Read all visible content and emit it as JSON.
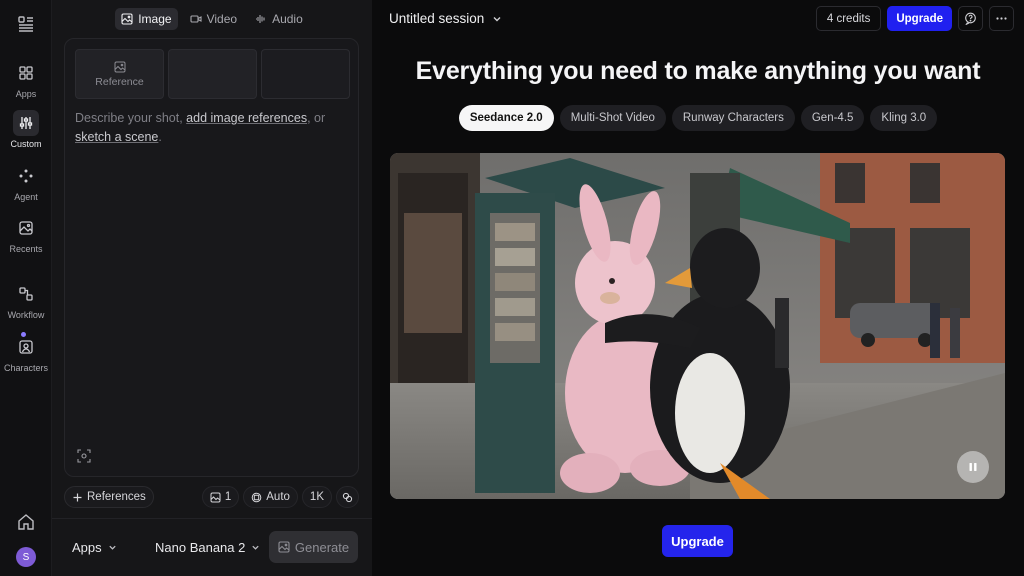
{
  "rail": {
    "items": [
      {
        "label": "Apps",
        "icon": "apps-grid-icon"
      },
      {
        "label": "Custom",
        "icon": "sliders-icon"
      },
      {
        "label": "Agent",
        "icon": "agent-nodes-icon"
      },
      {
        "label": "Recents",
        "icon": "recents-image-icon"
      },
      {
        "label": "Workflow",
        "icon": "workflow-icon"
      },
      {
        "label": "Characters",
        "icon": "character-icon"
      }
    ],
    "avatar_initial": "S",
    "active_item": "Custom"
  },
  "panel": {
    "modes": [
      {
        "label": "Image",
        "icon": "image-icon",
        "active": true
      },
      {
        "label": "Video",
        "icon": "video-icon",
        "active": false
      },
      {
        "label": "Audio",
        "icon": "audio-wave-icon",
        "active": false
      }
    ],
    "reference_slot_label": "Reference",
    "prompt": {
      "text_1": "Describe your shot, ",
      "link_1": "add image references",
      "text_2": ", or ",
      "link_2": "sketch a scene",
      "text_3": "."
    },
    "tools": {
      "references_label": "References",
      "count": "1",
      "aspect": "Auto",
      "resolution": "1K"
    },
    "apps_label": "Apps",
    "model_label": "Nano Banana 2",
    "generate_label": "Generate"
  },
  "main": {
    "session_title": "Untitled session",
    "credits": "4 credits",
    "upgrade_small": "Upgrade",
    "headline": "Everything you need to make anything you want",
    "models": [
      {
        "label": "Seedance 2.0",
        "active": true
      },
      {
        "label": "Multi-Shot Video",
        "active": false
      },
      {
        "label": "Runway Characters",
        "active": false
      },
      {
        "label": "Gen-4.5",
        "active": false
      },
      {
        "label": "Kling 3.0",
        "active": false
      }
    ],
    "upgrade_large": "Upgrade"
  },
  "colors": {
    "accent_blue": "#2020f0",
    "avatar_purple": "#7e5bd6",
    "notification_dot": "#8b7bff"
  }
}
